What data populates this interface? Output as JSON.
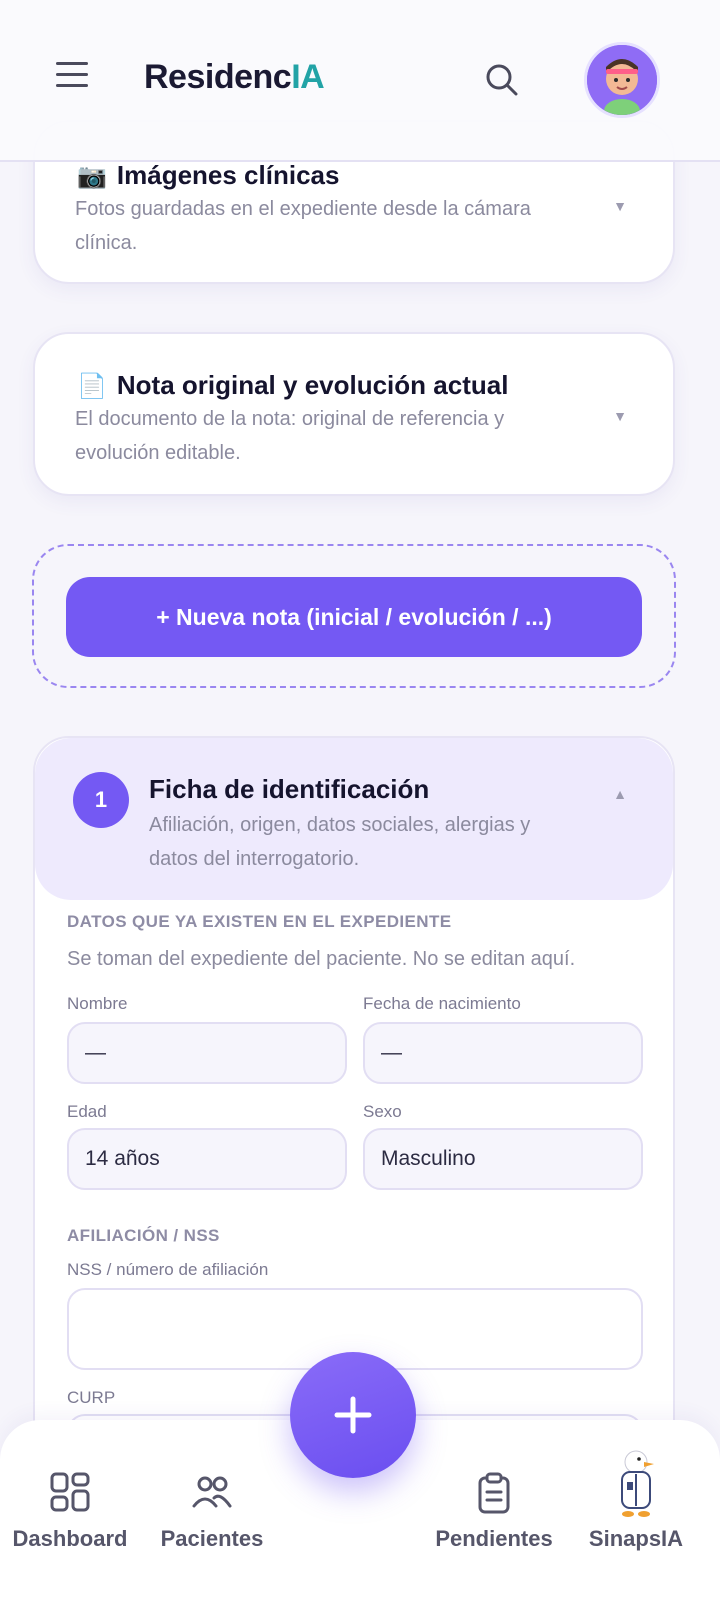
{
  "header": {
    "brand_main": "Residenc",
    "brand_accent": "IA"
  },
  "cards": {
    "images": {
      "emoji": "📷",
      "title": "Imágenes clínicas",
      "subtitle": "Fotos guardadas en el expediente desde la cámara clínica."
    },
    "note": {
      "emoji": "📄",
      "title": "Nota original y evolución actual",
      "subtitle": "El documento de la nota: original de referencia y evolución editable."
    }
  },
  "new_note_button": "+  Nueva nota (inicial / evolución / ...)",
  "section": {
    "number": "1",
    "title": "Ficha de identificación",
    "subtitle": "Afiliación, origen, datos sociales, alergias y datos del interrogatorio.",
    "existing_label": "DATOS QUE YA EXISTEN EN EL EXPEDIENTE",
    "existing_help": "Se toman del expediente del paciente. No se editan aquí.",
    "fields": {
      "nombre_label": "Nombre",
      "nombre_value": "—",
      "nacimiento_label": "Fecha de nacimiento",
      "nacimiento_value": "—",
      "edad_label": "Edad",
      "edad_value": "14 años",
      "sexo_label": "Sexo",
      "sexo_value": "Masculino"
    },
    "afiliacion_label": "AFILIACIÓN / NSS",
    "nss_label": "NSS / número de afiliación",
    "nss_value": "",
    "curp_label": "CURP"
  },
  "bottom_nav": {
    "dashboard": "Dashboard",
    "pacientes": "Pacientes",
    "pendientes": "Pendientes",
    "sinapsia": "SinapsIA"
  },
  "icons": {
    "menu": "menu-icon",
    "search": "search-icon",
    "caret_down": "▼",
    "caret_up": "▲"
  },
  "colors": {
    "accent": "#7459f3",
    "brand_teal": "#22a3a6",
    "section_bg": "#eeeafd"
  }
}
